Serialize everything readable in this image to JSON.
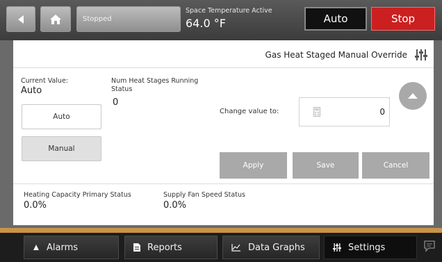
{
  "topbar": {
    "status": "Stopped",
    "space_label": "Space Temperature Active",
    "space_value": "64.0 °F",
    "auto_label": "Auto",
    "stop_label": "Stop",
    "stop_color": "#cc1f1f"
  },
  "panel": {
    "title": "Gas Heat Staged Manual Override",
    "current_value_label": "Current Value:",
    "current_value": "Auto",
    "num_stages_label_line1": "Num Heat Stages Running",
    "num_stages_label_line2": "Status",
    "num_stages_value": "0",
    "mode_buttons": {
      "auto": "Auto",
      "manual": "Manual"
    },
    "change_label": "Change value to:",
    "change_value": "0",
    "actions": {
      "apply": "Apply",
      "save": "Save",
      "cancel": "Cancel"
    },
    "heating_label": "Heating Capacity Primary Status",
    "heating_value": "0.0%",
    "fan_label": "Supply Fan Speed Status",
    "fan_value": "0.0%"
  },
  "nav": {
    "alarms": "Alarms",
    "reports": "Reports",
    "data_graphs": "Data Graphs",
    "settings": "Settings"
  },
  "icons": {
    "back": "back-arrow-icon",
    "home": "home-icon",
    "sliders": "sliders-icon",
    "calculator": "calculator-icon",
    "up": "chevron-up-icon",
    "bell": "alarm-bell-icon",
    "document": "document-icon",
    "chart": "chart-icon",
    "chat": "chat-bubble-icon"
  },
  "colors": {
    "accent_strip": "#c89448",
    "button_gray": "#a9a9a9"
  }
}
